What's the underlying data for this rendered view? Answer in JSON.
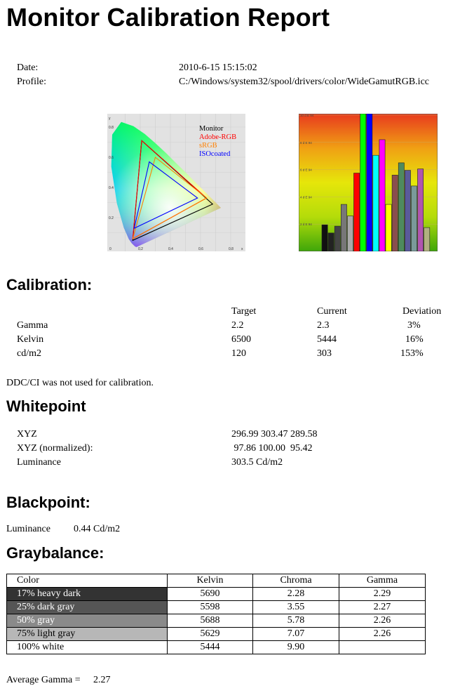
{
  "title": "Monitor Calibration Report",
  "meta": {
    "date_label": "Date:",
    "date_value": "2010-6-15 15:15:02",
    "profile_label": "Profile:",
    "profile_value": "C:/Windows/system32/spool/drivers/color/WideGamutRGB.icc"
  },
  "cie_chart": {
    "legend": [
      "Monitor",
      "Adobe-RGB",
      "sRGB",
      "ISOcoated"
    ],
    "legend_colors": [
      "#000000",
      "#ff0000",
      "#ff8000",
      "#0000ff"
    ],
    "y_axis_label": "y",
    "x_axis_label": "x",
    "x_ticks": [
      "0",
      "0.2",
      "0.4",
      "0.6",
      "0.8"
    ],
    "y_ticks": [
      "0.2",
      "0.4",
      "0.6",
      "0.8"
    ],
    "gamuts": {
      "Monitor": [
        [
          0.21,
          0.71
        ],
        [
          0.68,
          0.29
        ],
        [
          0.15,
          0.05
        ]
      ],
      "Adobe-RGB": [
        [
          0.21,
          0.71
        ],
        [
          0.64,
          0.33
        ],
        [
          0.15,
          0.06
        ]
      ],
      "sRGB": [
        [
          0.3,
          0.6
        ],
        [
          0.64,
          0.33
        ],
        [
          0.15,
          0.06
        ]
      ],
      "ISOcoated": [
        [
          0.26,
          0.57
        ],
        [
          0.58,
          0.33
        ],
        [
          0.16,
          0.13
        ]
      ]
    }
  },
  "chart_data": {
    "type": "bar",
    "y_ticks": [
      "2 d E 94",
      "4 d E 94",
      "6 d E 94",
      "8 d E 94",
      "10 d E 94"
    ],
    "ylim": [
      0,
      10
    ],
    "values": [
      1.95,
      1.35,
      1.85,
      3.45,
      2.6,
      5.75,
      10.2,
      10.2,
      7.05,
      8.2,
      3.45,
      5.6,
      6.5,
      5.95,
      4.8,
      6.05,
      1.75
    ],
    "colors": [
      "#111111",
      "#222222",
      "#444444",
      "#777777",
      "#aaaaaa",
      "#ff0000",
      "#00ff00",
      "#0000ff",
      "#00ffff",
      "#ff00ff",
      "#ffff00",
      "#8a4e4e",
      "#4e8a5e",
      "#5a5a9a",
      "#7a9a9a",
      "#b055b0",
      "#b0b080"
    ]
  },
  "calibration": {
    "heading": "Calibration:",
    "headers": [
      "Target",
      "Current",
      "Deviation"
    ],
    "rows": [
      {
        "label": "Gamma",
        "target": "2.2",
        "current": "2.3",
        "deviation": "3%"
      },
      {
        "label": "Kelvin",
        "target": "6500",
        "current": "5444",
        "deviation": "16%"
      },
      {
        "label": "cd/m2",
        "target": "120",
        "current": "303",
        "deviation": "153%"
      }
    ],
    "note": "DDC/CI was not used for calibration."
  },
  "whitepoint": {
    "heading": "Whitepoint",
    "rows": [
      {
        "label": "XYZ",
        "value": "296.99 303.47 289.58"
      },
      {
        "label": "XYZ (normalized):",
        "value": " 97.86 100.00  95.42"
      },
      {
        "label": "Luminance",
        "value": "303.5 Cd/m2"
      }
    ]
  },
  "blackpoint": {
    "heading": "Blackpoint:",
    "label": "Luminance",
    "value": "0.44 Cd/m2"
  },
  "graybalance": {
    "heading": "Graybalance:",
    "headers": [
      "Color",
      "Kelvin",
      "Chroma",
      "Gamma"
    ],
    "rows": [
      {
        "color": "17% heavy dark",
        "kelvin": "5690",
        "chroma": "2.28",
        "gamma": "2.29"
      },
      {
        "color": "25% dark gray",
        "kelvin": "5598",
        "chroma": "3.55",
        "gamma": "2.27"
      },
      {
        "color": "50% gray",
        "kelvin": "5688",
        "chroma": "5.78",
        "gamma": "2.26"
      },
      {
        "color": "75% light gray",
        "kelvin": "5629",
        "chroma": "7.07",
        "gamma": "2.26"
      },
      {
        "color": "100% white",
        "kelvin": "5444",
        "chroma": "9.90",
        "gamma": ""
      }
    ],
    "average_label": "Average Gamma =",
    "average_value": "2.27"
  }
}
